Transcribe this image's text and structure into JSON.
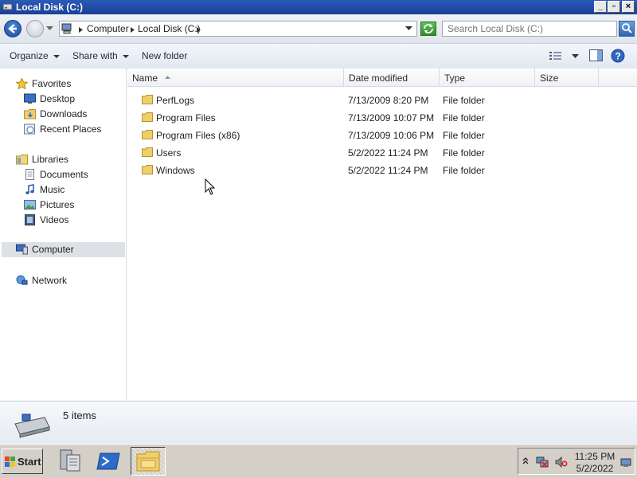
{
  "window": {
    "title": "Local Disk (C:)",
    "controls": [
      "_",
      "▫",
      "×"
    ]
  },
  "address": {
    "crumbs": [
      "Computer",
      "Local Disk (C:)"
    ],
    "search_placeholder": "Search Local Disk (C:)"
  },
  "toolbar": {
    "organize": "Organize",
    "share_with": "Share with",
    "new_folder": "New folder"
  },
  "nav": {
    "favorites": {
      "label": "Favorites",
      "items": [
        "Desktop",
        "Downloads",
        "Recent Places"
      ]
    },
    "libraries": {
      "label": "Libraries",
      "items": [
        "Documents",
        "Music",
        "Pictures",
        "Videos"
      ]
    },
    "computer": "Computer",
    "network": "Network"
  },
  "columns": [
    "Name",
    "Date modified",
    "Type",
    "Size"
  ],
  "files": [
    {
      "name": "PerfLogs",
      "date": "7/13/2009 8:20 PM",
      "type": "File folder"
    },
    {
      "name": "Program Files",
      "date": "7/13/2009 10:07 PM",
      "type": "File folder"
    },
    {
      "name": "Program Files (x86)",
      "date": "7/13/2009 10:06 PM",
      "type": "File folder"
    },
    {
      "name": "Users",
      "date": "5/2/2022 11:24 PM",
      "type": "File folder"
    },
    {
      "name": "Windows",
      "date": "5/2/2022 11:24 PM",
      "type": "File folder"
    }
  ],
  "details": {
    "count": "5 items"
  },
  "taskbar": {
    "start": "Start",
    "time": "11:25 PM",
    "date": "5/2/2022"
  }
}
